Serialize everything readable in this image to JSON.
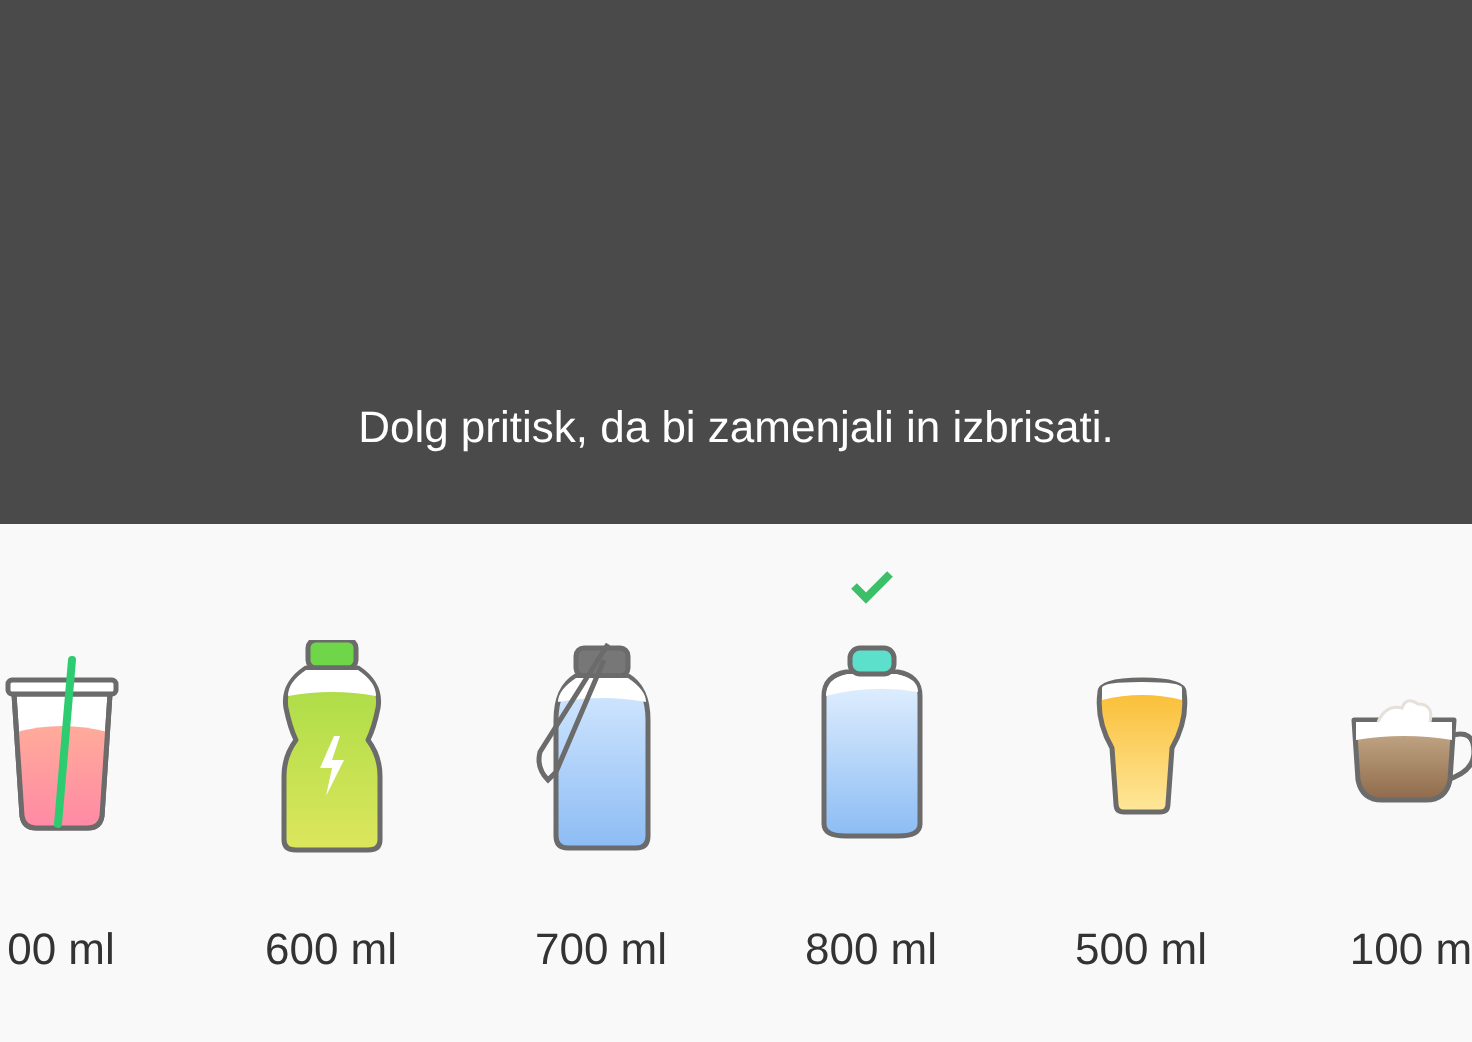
{
  "hint": {
    "text": "Dolg pritisk, da bi zamenjali in izbrisati."
  },
  "drinks": [
    {
      "kind": "cup",
      "label": "00 ml",
      "selected": false
    },
    {
      "kind": "sport",
      "label": "600 ml",
      "selected": false
    },
    {
      "kind": "flask",
      "label": "700 ml",
      "selected": false
    },
    {
      "kind": "bottle",
      "label": "800 ml",
      "selected": true
    },
    {
      "kind": "beer",
      "label": "500 ml",
      "selected": false
    },
    {
      "kind": "coffee",
      "label": "100 m",
      "selected": false
    }
  ]
}
